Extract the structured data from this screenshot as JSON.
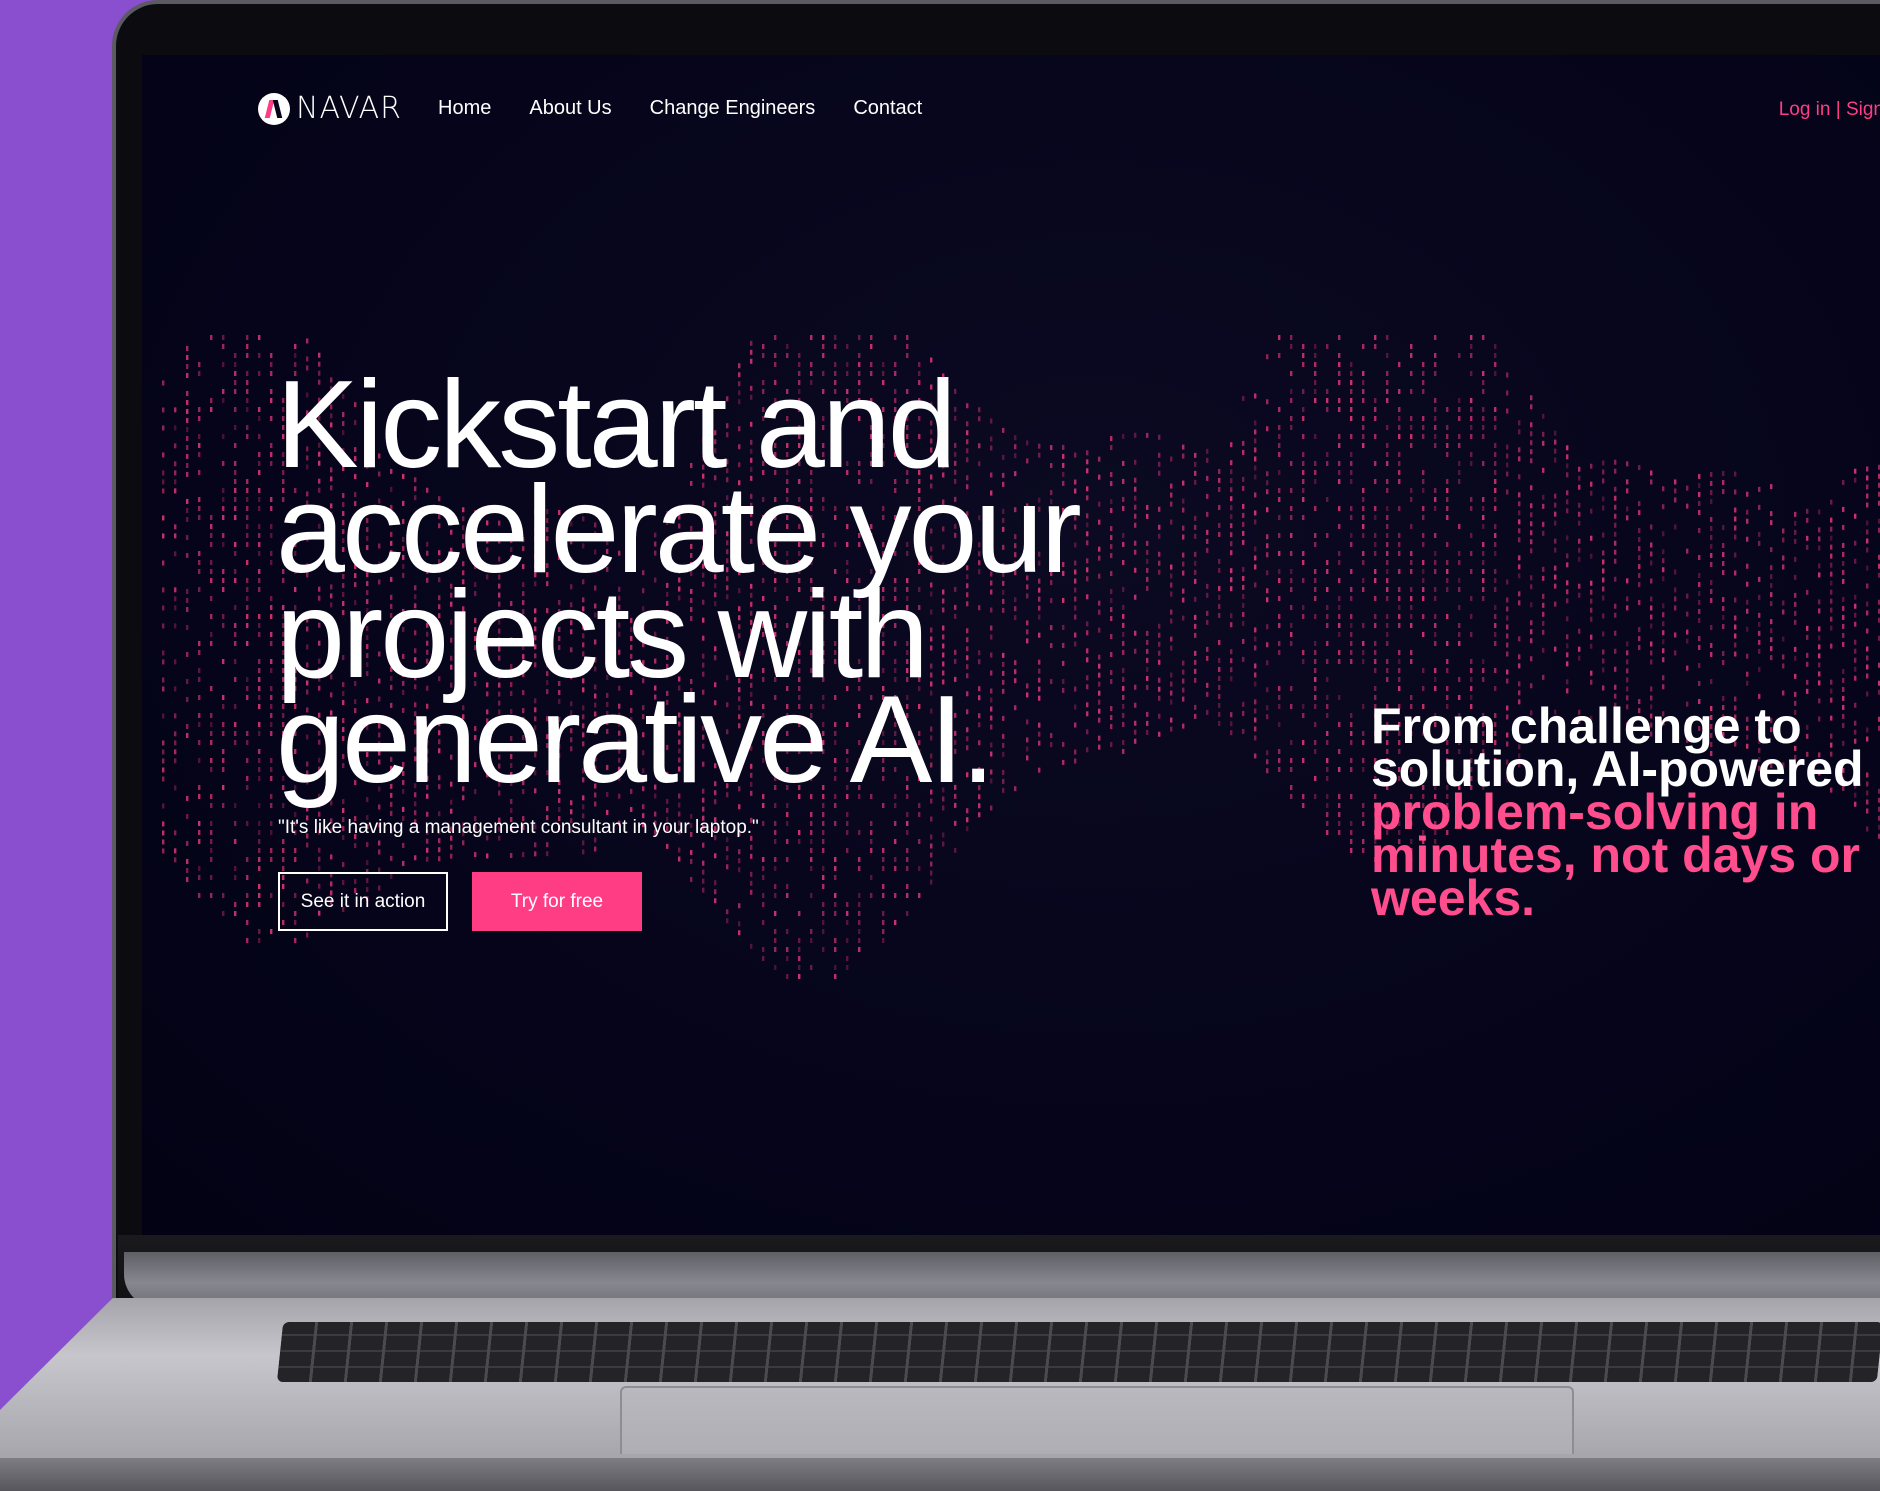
{
  "nav": {
    "logo_text": "NAVAR",
    "links": [
      "Home",
      "About Us",
      "Change Engineers",
      "Contact"
    ],
    "auth": "Log in | Sign"
  },
  "hero": {
    "title": "Kickstart and accelerate your projects with generative AI.",
    "quote": "\"It's like having a management consultant in your laptop.\"",
    "btn_secondary": "See it in action",
    "btn_primary": "Try for free"
  },
  "tagline": {
    "white": "From challenge to solution, AI-powered",
    "pink": "problem-solving in minutes, not days or weeks."
  },
  "colors": {
    "background": "#8a4fcf",
    "screen": "#05041a",
    "accent": "#ff3d85"
  }
}
